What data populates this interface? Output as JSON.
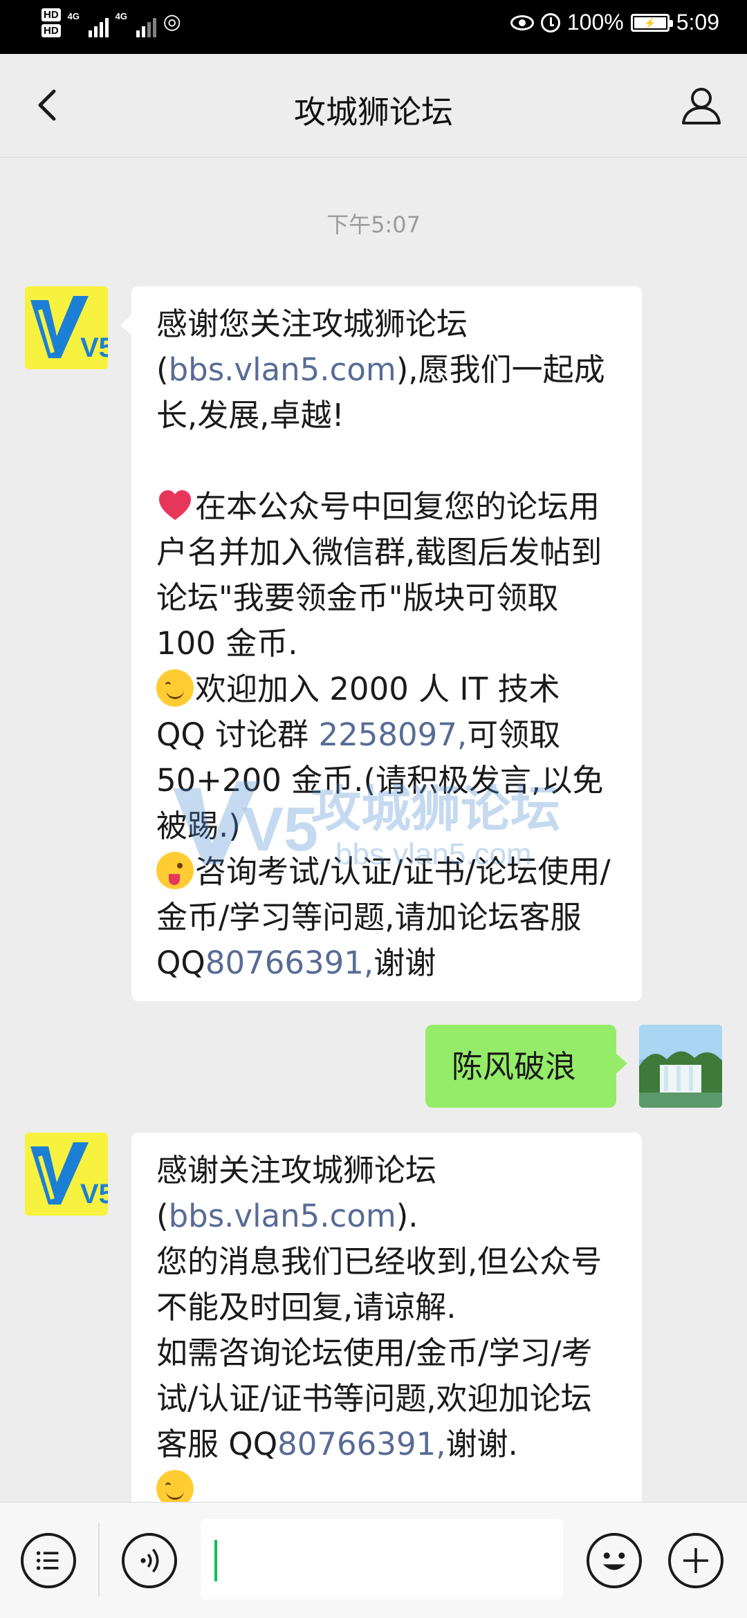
{
  "status_bar": {
    "hd1": "HD",
    "hd2": "HD",
    "net1": "4G",
    "net2": "4G",
    "battery_percent": "100%",
    "time": "5:09"
  },
  "header": {
    "title": "攻城狮论坛"
  },
  "time_label": "下午5:07",
  "messages": [
    {
      "sender": "bot",
      "parts": {
        "p1a": "感谢您关注攻城狮论坛(",
        "p1link": "bbs.vlan5.com",
        "p1b": "),愿我们一起成长,发展,卓越!",
        "p2": "在本公众号中回复您的论坛用户名并加入微信群,截图后发帖到论坛\"我要领金币\"版块可领取 100 金币.",
        "p3a": "欢迎加入 2000 人 IT 技术 QQ 讨论群 ",
        "p3link": "2258097,",
        "p3b": "可领取 50+200 金币.(请积极发言,以免被踢.)",
        "p4a": "咨询考试/认证/证书/论坛使用/金币/学习等问题,请加论坛客服 QQ",
        "p4link": "80766391,",
        "p4b": "谢谢"
      }
    },
    {
      "sender": "me",
      "text": "陈风破浪"
    },
    {
      "sender": "bot",
      "parts": {
        "p1a": "感谢关注攻城狮论坛(",
        "p1link": "bbs.vlan5.com",
        "p1b": ").",
        "p2": "您的消息我们已经收到,但公众号不能及时回复,请谅解.",
        "p3a": "如需咨询论坛使用/金币/学习/考试/认证/证书等问题,欢迎加论坛客服 QQ",
        "p3link": "80766391,",
        "p3b": "谢谢."
      }
    }
  ],
  "watermark": {
    "brand": "攻城狮论坛",
    "url": "bbs.vlan5.com",
    "logo": "V5"
  },
  "avatar_logo": "V5",
  "input": {
    "value": ""
  },
  "colors": {
    "link": "#576b95",
    "outgoing_bubble": "#95ec69",
    "caret": "#07c160",
    "logo_bg": "#f7f240",
    "logo_blue": "#1c7fd6"
  }
}
